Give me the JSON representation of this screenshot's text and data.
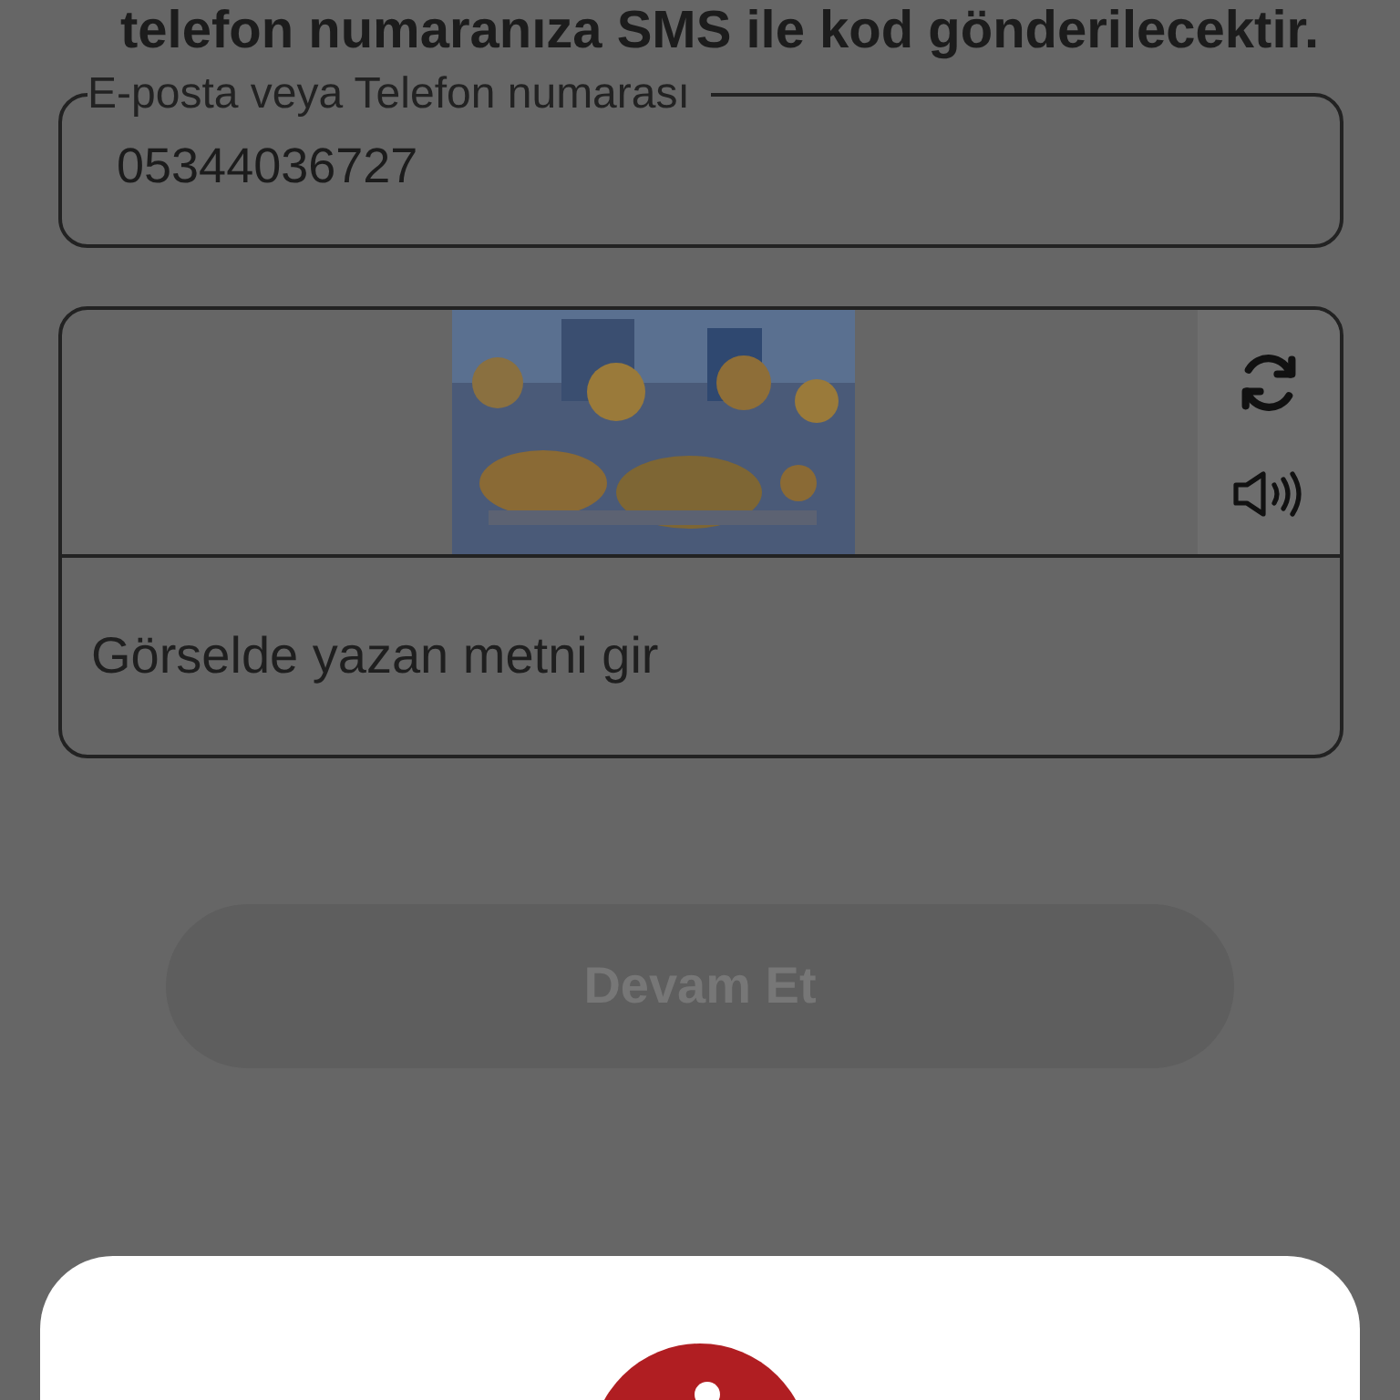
{
  "intro_text": "telefon numaranıza SMS ile kod gönderilecektir.",
  "contact_field": {
    "label": "E-posta veya Telefon numarası",
    "value": "05344036727"
  },
  "captcha": {
    "answer_field": {
      "placeholder": "Görselde yazan metni gir"
    }
  },
  "continue_button": {
    "label": "Devam Et",
    "disabled": true
  },
  "alert_sheet": {
    "visible": true
  }
}
